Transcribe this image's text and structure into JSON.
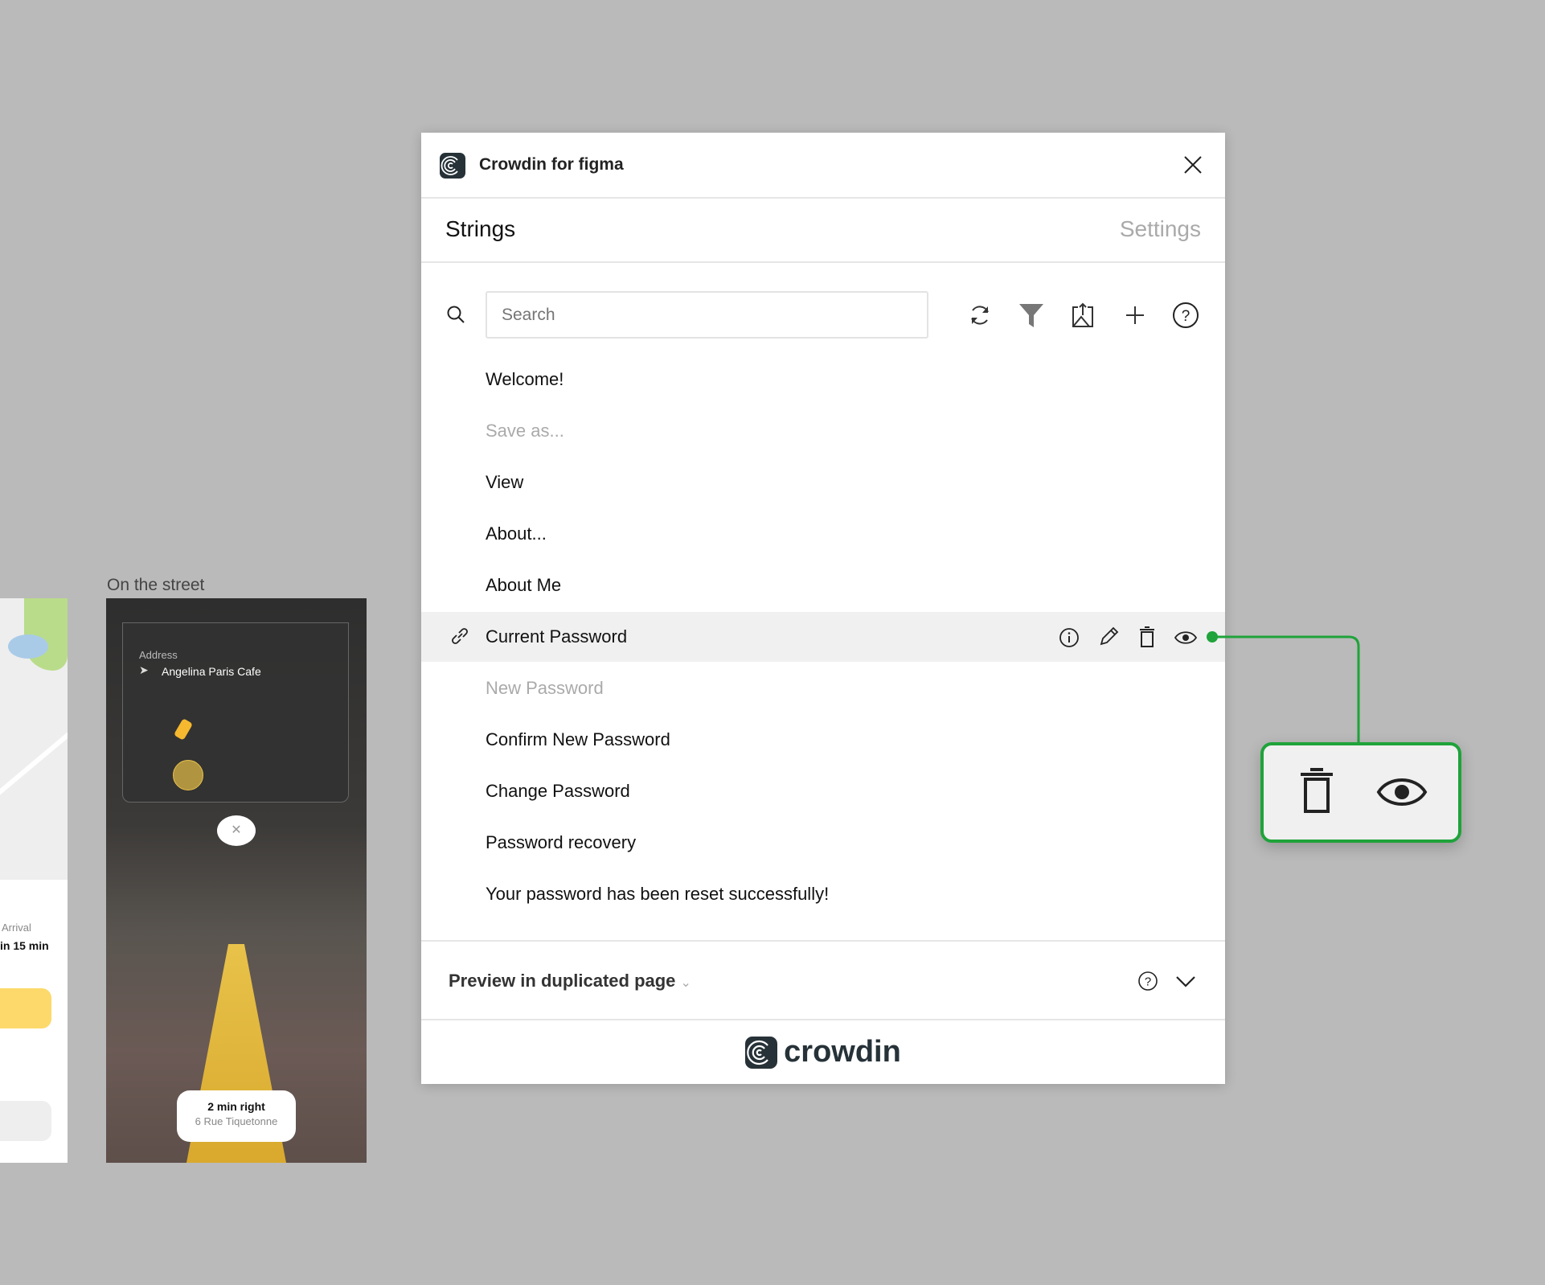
{
  "window": {
    "title": "Crowdin for figma",
    "close_icon": "close-icon"
  },
  "tabs": {
    "strings": "Strings",
    "settings": "Settings"
  },
  "search": {
    "placeholder": "Search",
    "value": ""
  },
  "toolbar": [
    "refresh-icon",
    "filter-icon",
    "upload-screenshot-icon",
    "plus-icon",
    "help-icon"
  ],
  "strings": [
    {
      "text": "Welcome!",
      "muted": false
    },
    {
      "text": "Save as...",
      "muted": true
    },
    {
      "text": "View",
      "muted": false
    },
    {
      "text": "About...",
      "muted": false
    },
    {
      "text": "About Me",
      "muted": false
    },
    {
      "text": "Current Password",
      "muted": false,
      "selected": true,
      "actions": [
        "info-icon",
        "pencil-icon",
        "trash-icon",
        "eye-icon"
      ]
    },
    {
      "text": "New Password",
      "muted": true
    },
    {
      "text": "Confirm New Password",
      "muted": false
    },
    {
      "text": "Change Password",
      "muted": false
    },
    {
      "text": "Password recovery",
      "muted": false
    },
    {
      "text": "Your password has been reset successfully!",
      "muted": false
    }
  ],
  "footer": {
    "preview_label": "Preview in duplicated page"
  },
  "brand": {
    "name": "crowdin"
  },
  "accent": "#1fa33a",
  "canvas": {
    "frame_title": "On the street",
    "address_label": "Address",
    "address_value": "Angelina Paris Cafe",
    "direction": "2 min right",
    "direction_address": "6 Rue Tiquetonne",
    "arrival_label": "Arrival",
    "arrival_value": "in 15 min"
  }
}
